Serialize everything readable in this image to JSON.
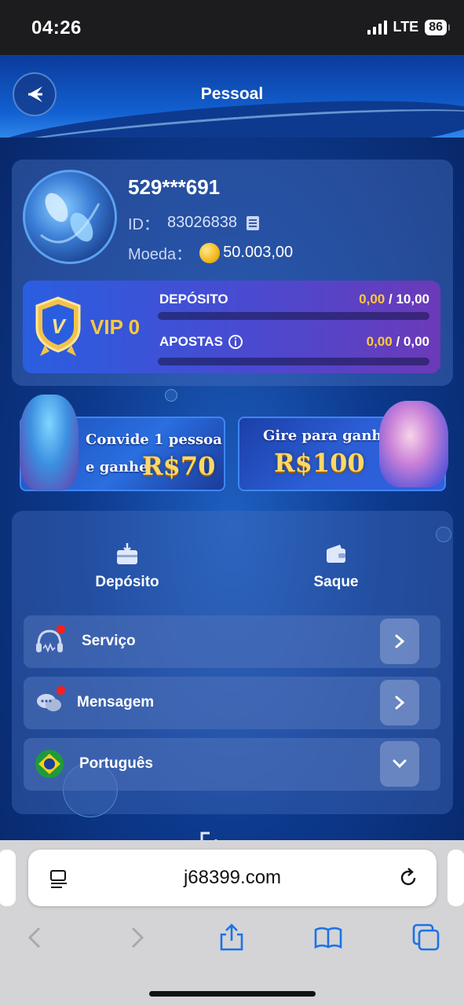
{
  "status_bar": {
    "time": "04:26",
    "network": "LTE",
    "battery": "86"
  },
  "header": {
    "title": "Pessoal"
  },
  "profile": {
    "username": "529***691",
    "id_label": "ID：",
    "id_value": "83026838",
    "coin_label": "Moeda：",
    "coin_value": "50.003,00"
  },
  "vip": {
    "badge_letter": "V",
    "label": "VIP 0",
    "deposit_label": "DEPÓSITO",
    "deposit_current": "0,00",
    "deposit_target": "/ 10,00",
    "deposit_progress": 0,
    "bets_label": "APOSTAS",
    "bets_current": "0,00",
    "bets_target": "/ 0,00",
    "bets_progress": 0
  },
  "banners": [
    {
      "line1": "Convide 1 pessoa",
      "line2": "e ganhe",
      "amount": "R$70"
    },
    {
      "line1": "Gire para ganhar",
      "amount": "R$100"
    }
  ],
  "actions": {
    "deposit": "Depósito",
    "withdraw": "Saque"
  },
  "menu": {
    "service": "Serviço",
    "message": "Mensagem",
    "language": "Português"
  },
  "browser": {
    "url": "j68399.com"
  },
  "colors": {
    "accent_gold": "#ffc93c",
    "notification_red": "#ff1e1e",
    "app_bg": "#0d3a8e"
  }
}
